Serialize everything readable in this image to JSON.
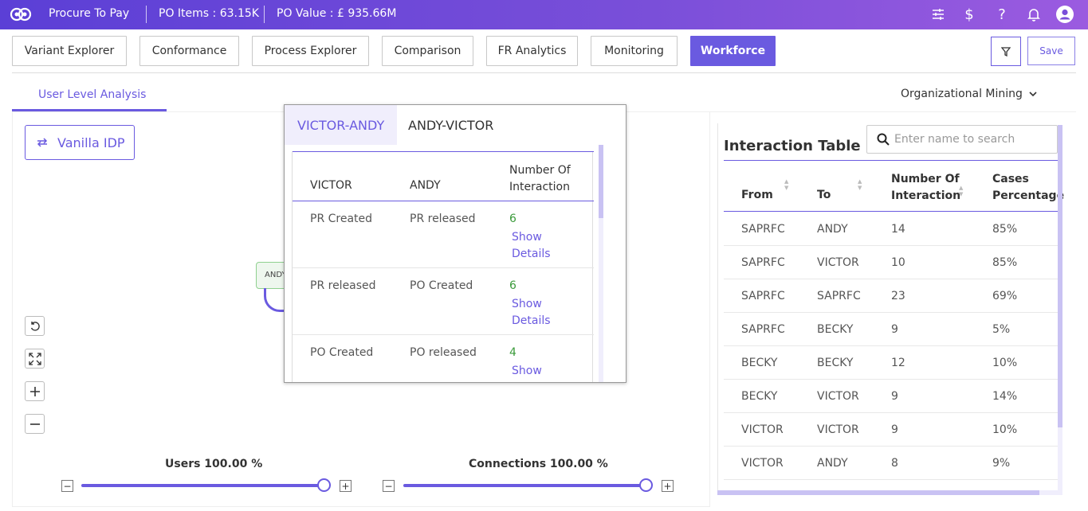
{
  "topbar": {
    "app_name": "Procure To Pay",
    "po_items": "PO Items : 63.15K",
    "po_value": "PO Value : £ 935.66M",
    "icons": [
      "sliders-icon",
      "dollar-icon",
      "help-icon",
      "bell-icon",
      "user-icon"
    ]
  },
  "nav": {
    "tabs": [
      "Variant Explorer",
      "Conformance",
      "Process Explorer",
      "Comparison",
      "FR Analytics",
      "Monitoring",
      "Workforce"
    ],
    "active": "Workforce",
    "save_label": "Save"
  },
  "subnav": {
    "tab": "User Level Analysis",
    "dropdown": "Organizational Mining"
  },
  "graph": {
    "idp_button": "Vanilla IDP",
    "node_label": "ANDY",
    "users_label": "Users 100.00 %",
    "users_value": 1.0,
    "connections_label": "Connections 100.00 %",
    "connections_value": 1.0
  },
  "popup": {
    "tabs": [
      "VICTOR-ANDY",
      "ANDY-VICTOR"
    ],
    "active_tab": "VICTOR-ANDY",
    "headers": [
      "VICTOR",
      "ANDY",
      "Number Of Interaction"
    ],
    "rows": [
      {
        "from": "PR Created",
        "to": "PR released",
        "count": "6",
        "link": "Show Details"
      },
      {
        "from": "PR released",
        "to": "PO Created",
        "count": "6",
        "link": "Show Details"
      },
      {
        "from": "PO Created",
        "to": "PO released",
        "count": "4",
        "link": "Show Details"
      }
    ]
  },
  "interaction_table": {
    "title": "Interaction Table",
    "search_placeholder": "Enter name to search",
    "headers": [
      "From",
      "To",
      "Number Of Interaction",
      "Cases Percentage"
    ],
    "rows": [
      {
        "from": "SAPRFC",
        "to": "ANDY",
        "count": "14",
        "pct": "85%"
      },
      {
        "from": "SAPRFC",
        "to": "VICTOR",
        "count": "10",
        "pct": "85%"
      },
      {
        "from": "SAPRFC",
        "to": "SAPRFC",
        "count": "23",
        "pct": "69%"
      },
      {
        "from": "SAPRFC",
        "to": "BECKY",
        "count": "9",
        "pct": "5%"
      },
      {
        "from": "BECKY",
        "to": "BECKY",
        "count": "12",
        "pct": "10%"
      },
      {
        "from": "BECKY",
        "to": "VICTOR",
        "count": "9",
        "pct": "14%"
      },
      {
        "from": "VICTOR",
        "to": "VICTOR",
        "count": "9",
        "pct": "10%"
      },
      {
        "from": "VICTOR",
        "to": "ANDY",
        "count": "8",
        "pct": "9%"
      }
    ]
  },
  "colors": {
    "accent": "#6a5ae0",
    "topbar_start": "#5b3fd6",
    "topbar_end": "#9b5be0",
    "count_green": "#3a9a3a"
  }
}
